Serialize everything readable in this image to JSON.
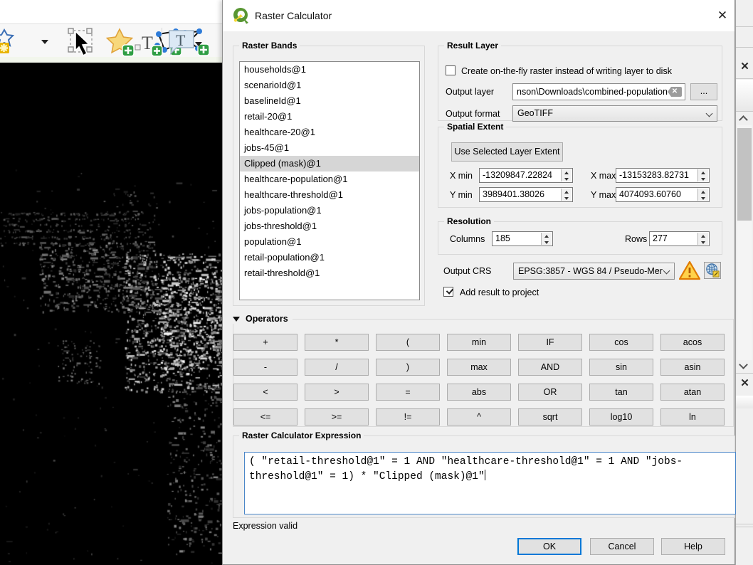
{
  "colors": {
    "accent": "#0078d7",
    "list_selection": "#d6d6d6",
    "expression_border": "#4a86c8",
    "warning_yellow": "#ffd24a",
    "warning_border": "#e07b00",
    "logo_green": "#589632",
    "logo_yellow": "#f6d837"
  },
  "window": {
    "title": "Raster Calculator",
    "close_glyph": "✕"
  },
  "background_toolbar": {
    "icon_names": [
      "style-star-icon",
      "dropdown-caret-icon",
      "select-annotation-icon",
      "polygon-annotation-icon",
      "line-annotation-icon",
      "marker-annotation-icon",
      "text-annotation-icon",
      "balloon-annotation-icon",
      "dropdown-caret-icon"
    ]
  },
  "right_dock": {
    "panel_close_glyph": "✕"
  },
  "raster_bands": {
    "label": "Raster Bands",
    "selected_index": 6,
    "items": [
      "households@1",
      "scenarioId@1",
      "baselineId@1",
      "retail-20@1",
      "healthcare-20@1",
      "jobs-45@1",
      "Clipped (mask)@1",
      "healthcare-population@1",
      "healthcare-threshold@1",
      "jobs-population@1",
      "jobs-threshold@1",
      "population@1",
      "retail-population@1",
      "retail-threshold@1"
    ]
  },
  "result_layer": {
    "label": "Result Layer",
    "create_otf_label": "Create on-the-fly raster instead of writing layer to disk",
    "create_otf_checked": false,
    "output_layer_label": "Output layer",
    "output_layer_value": "nson\\Downloads\\combined-population",
    "clear_glyph": "✕",
    "browse_label": "...",
    "output_format_label": "Output format",
    "output_format_value": "GeoTIFF"
  },
  "spatial_extent": {
    "label": "Spatial Extent",
    "use_selected_label": "Use Selected Layer Extent",
    "x_min_label": "X min",
    "x_min": "-13209847.22824",
    "x_max_label": "X max",
    "x_max": "-13153283.82731",
    "y_min_label": "Y min",
    "y_min": "3989401.38026",
    "y_max_label": "Y max",
    "y_max": "4074093.60760"
  },
  "resolution": {
    "label": "Resolution",
    "columns_label": "Columns",
    "columns": "185",
    "rows_label": "Rows",
    "rows": "277"
  },
  "output_crs": {
    "label": "Output CRS",
    "value": "EPSG:3857 - WGS 84 / Pseudo-Mer"
  },
  "add_result": {
    "label": "Add result to project",
    "checked": true
  },
  "operators": {
    "label": "Operators",
    "rows": [
      [
        "+",
        "*",
        "(",
        "min",
        "IF",
        "cos",
        "acos"
      ],
      [
        "-",
        "/",
        ")",
        "max",
        "AND",
        "sin",
        "asin"
      ],
      [
        "<",
        ">",
        "=",
        "abs",
        "OR",
        "tan",
        "atan"
      ],
      [
        "<=",
        ">=",
        "!=",
        "^",
        "sqrt",
        "log10",
        "ln"
      ]
    ]
  },
  "expression": {
    "label": "Raster Calculator Expression",
    "value": "( \"retail-threshold@1\" = 1 AND \"healthcare-threshold@1\" = 1 AND \"jobs-threshold@1\" = 1) * \"Clipped (mask)@1\"",
    "status": "Expression valid"
  },
  "footer": {
    "ok": "OK",
    "cancel": "Cancel",
    "help": "Help"
  }
}
